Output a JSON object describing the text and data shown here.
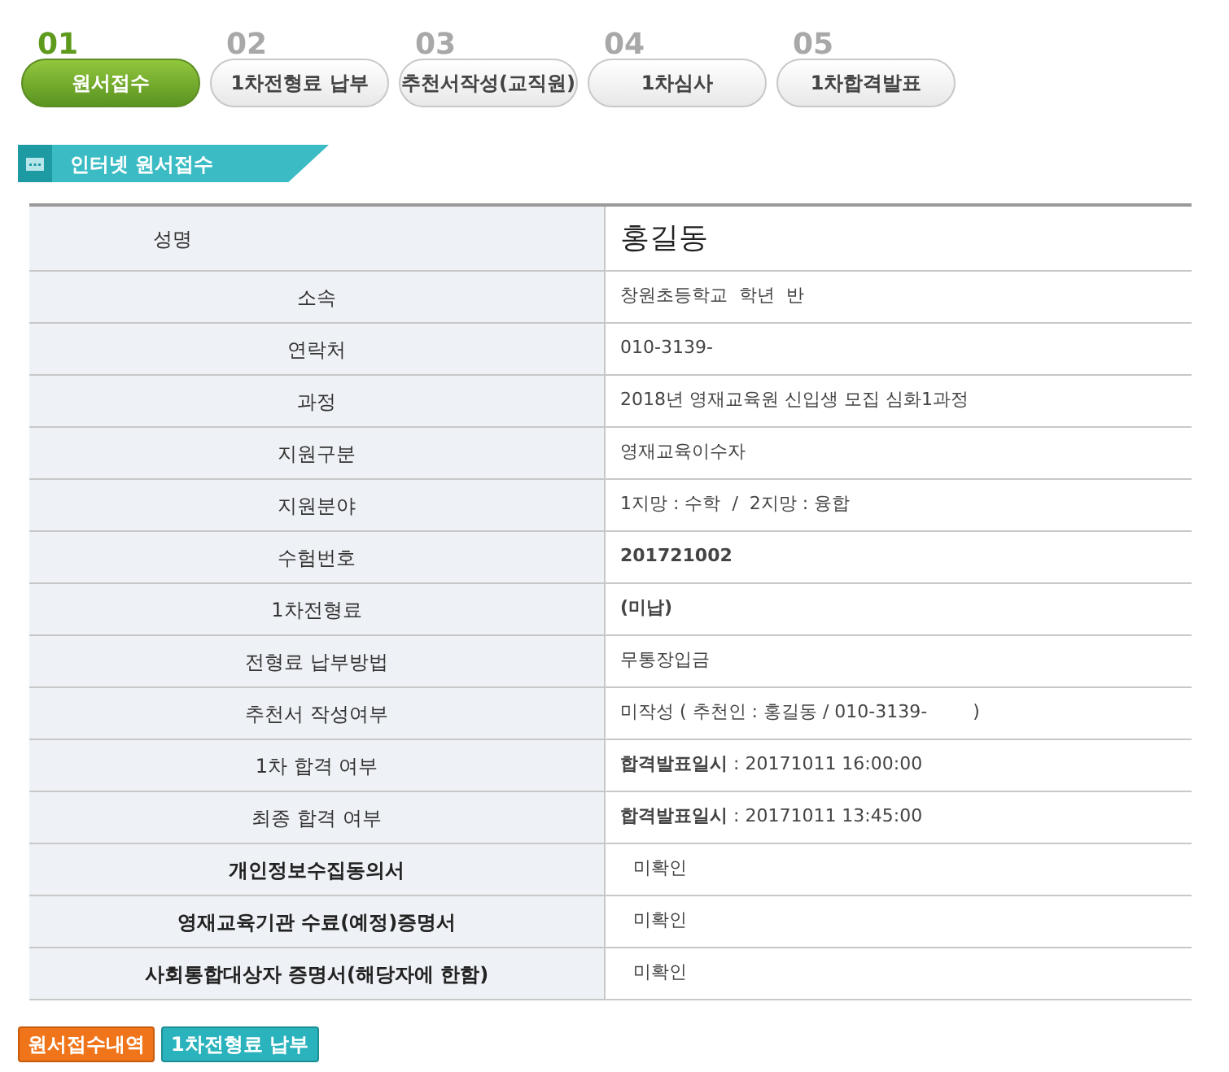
{
  "steps": [
    {
      "number": "01",
      "label": "원서접수",
      "selected": true
    },
    {
      "number": "02",
      "label": "1차전형료 납부",
      "selected": false
    },
    {
      "number": "03",
      "label": "추천서작성(교직원)",
      "selected": false
    },
    {
      "number": "04",
      "label": "1차심사",
      "selected": false
    },
    {
      "number": "05",
      "label": "1차합격발표",
      "selected": false
    }
  ],
  "section_title": "인터넷 원서접수",
  "rows": [
    {
      "kind": "name",
      "label": "성명",
      "value": "홍길동"
    },
    {
      "kind": "field",
      "label": "소속",
      "value": "창원초등학교  학년  반"
    },
    {
      "kind": "field",
      "label": "연락처",
      "value": "010-3139-"
    },
    {
      "kind": "field",
      "label": "과정",
      "value": "2018년 영재교육원 신입생 모집 심화1과정"
    },
    {
      "kind": "field",
      "label": "지원구분",
      "value": "영재교육이수자"
    },
    {
      "kind": "field",
      "label": "지원분야",
      "value": "1지망 : 수학  /  2지망 : 융합"
    },
    {
      "kind": "field",
      "label": "수험번호",
      "value": "**201721002**"
    },
    {
      "kind": "field",
      "label": "1차전형료",
      "value": "**(미납)**"
    },
    {
      "kind": "field",
      "label": "전형료 납부방법",
      "value": "무통장입금"
    },
    {
      "kind": "field",
      "label": "추천서 작성여부",
      "value": "미작성 ( 추천인 : 홍길동 / 010-3139-        )"
    },
    {
      "kind": "field",
      "label": "1차 합격 여부",
      "value": "**합격발표일시** : 20171011 16:00:00"
    },
    {
      "kind": "field",
      "label": "최종 합격 여부",
      "value": "**합격발표일시** : 20171011 13:45:00"
    },
    {
      "kind": "document",
      "label": "개인정보수집동의서",
      "value": "미확인"
    },
    {
      "kind": "document",
      "label": "영재교육기관 수료(예정)증명서",
      "value": "미확인"
    },
    {
      "kind": "document",
      "label": "사회통합대상자 증명서(해당자에 한함)",
      "value": "미확인"
    }
  ],
  "buttons": [
    {
      "label": "원서접수내역",
      "kind": "orange"
    },
    {
      "label": "1차전형료 납부",
      "kind": "teal"
    }
  ]
}
